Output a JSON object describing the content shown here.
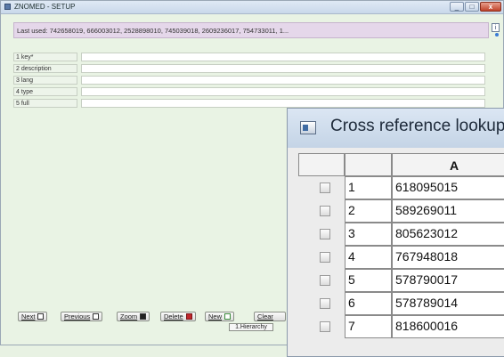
{
  "window": {
    "title": "ZNOMED - SETUP",
    "controls": {
      "minimize": "_",
      "maximize": "□",
      "close": "x"
    }
  },
  "last_used": "Last used: 742658019, 666003012, 2528898010, 745039018, 2609236017, 754733011, 1...",
  "info_icon": "i",
  "fields": [
    {
      "label": "1 key*",
      "value": ""
    },
    {
      "label": "2 description",
      "value": ""
    },
    {
      "label": "3 lang",
      "value": ""
    },
    {
      "label": "4 type",
      "value": ""
    },
    {
      "label": "5 full",
      "value": ""
    }
  ],
  "buttons": {
    "next": "Next",
    "previous": "Previous",
    "zoom": "Zoom",
    "delete": "Delete",
    "new": "New",
    "clear": "Clear",
    "hierarchy": "1.Hierarchy"
  },
  "dialog": {
    "title": "Cross reference lookup",
    "column_header": "A",
    "rows": [
      {
        "num": "1",
        "value": "618095015"
      },
      {
        "num": "2",
        "value": "589269011"
      },
      {
        "num": "3",
        "value": "805623012"
      },
      {
        "num": "4",
        "value": "767948018"
      },
      {
        "num": "5",
        "value": "578790017"
      },
      {
        "num": "6",
        "value": "578789014"
      },
      {
        "num": "7",
        "value": "818600016"
      }
    ]
  },
  "colors": {
    "background": "#e9f3e4",
    "last_used_bg": "#e5d7ea",
    "close_button": "#c0432a",
    "delete_icon": "#c0262c"
  }
}
